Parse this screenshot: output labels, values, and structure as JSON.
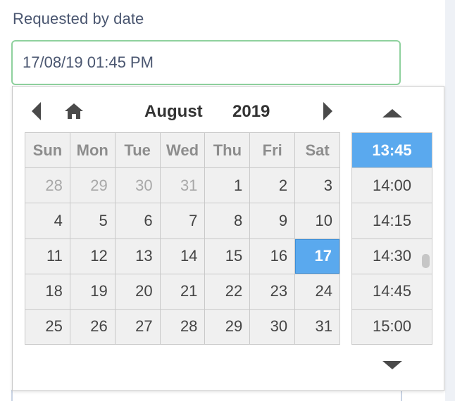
{
  "field": {
    "label": "Requested by date",
    "value": "17/08/19 01:45 PM"
  },
  "calendar": {
    "month": "August",
    "year": "2019",
    "weekdays": [
      "Sun",
      "Mon",
      "Tue",
      "Wed",
      "Thu",
      "Fri",
      "Sat"
    ],
    "weeks": [
      [
        {
          "d": "28",
          "muted": true
        },
        {
          "d": "29",
          "muted": true
        },
        {
          "d": "30",
          "muted": true
        },
        {
          "d": "31",
          "muted": true
        },
        {
          "d": "1"
        },
        {
          "d": "2"
        },
        {
          "d": "3"
        }
      ],
      [
        {
          "d": "4"
        },
        {
          "d": "5"
        },
        {
          "d": "6"
        },
        {
          "d": "7"
        },
        {
          "d": "8"
        },
        {
          "d": "9"
        },
        {
          "d": "10"
        }
      ],
      [
        {
          "d": "11"
        },
        {
          "d": "12"
        },
        {
          "d": "13"
        },
        {
          "d": "14"
        },
        {
          "d": "15"
        },
        {
          "d": "16"
        },
        {
          "d": "17",
          "selected": true
        }
      ],
      [
        {
          "d": "18"
        },
        {
          "d": "19"
        },
        {
          "d": "20"
        },
        {
          "d": "21"
        },
        {
          "d": "22"
        },
        {
          "d": "23"
        },
        {
          "d": "24"
        }
      ],
      [
        {
          "d": "25"
        },
        {
          "d": "26"
        },
        {
          "d": "27"
        },
        {
          "d": "28"
        },
        {
          "d": "29"
        },
        {
          "d": "30"
        },
        {
          "d": "31"
        }
      ]
    ]
  },
  "times": [
    {
      "t": "13:45",
      "selected": true
    },
    {
      "t": "14:00"
    },
    {
      "t": "14:15"
    },
    {
      "t": "14:30"
    },
    {
      "t": "14:45"
    },
    {
      "t": "15:00"
    }
  ],
  "icons": {
    "prev": "caret-left-icon",
    "home": "home-icon",
    "next": "caret-right-icon",
    "time_up": "caret-up-icon",
    "time_down": "caret-down-icon"
  },
  "colors": {
    "label_text": "#4a5670",
    "input_border": "#8fd19e",
    "selected": "#5aa9ee",
    "cell_bg": "#f0f0f0",
    "muted_day": "#a8a8a8"
  }
}
